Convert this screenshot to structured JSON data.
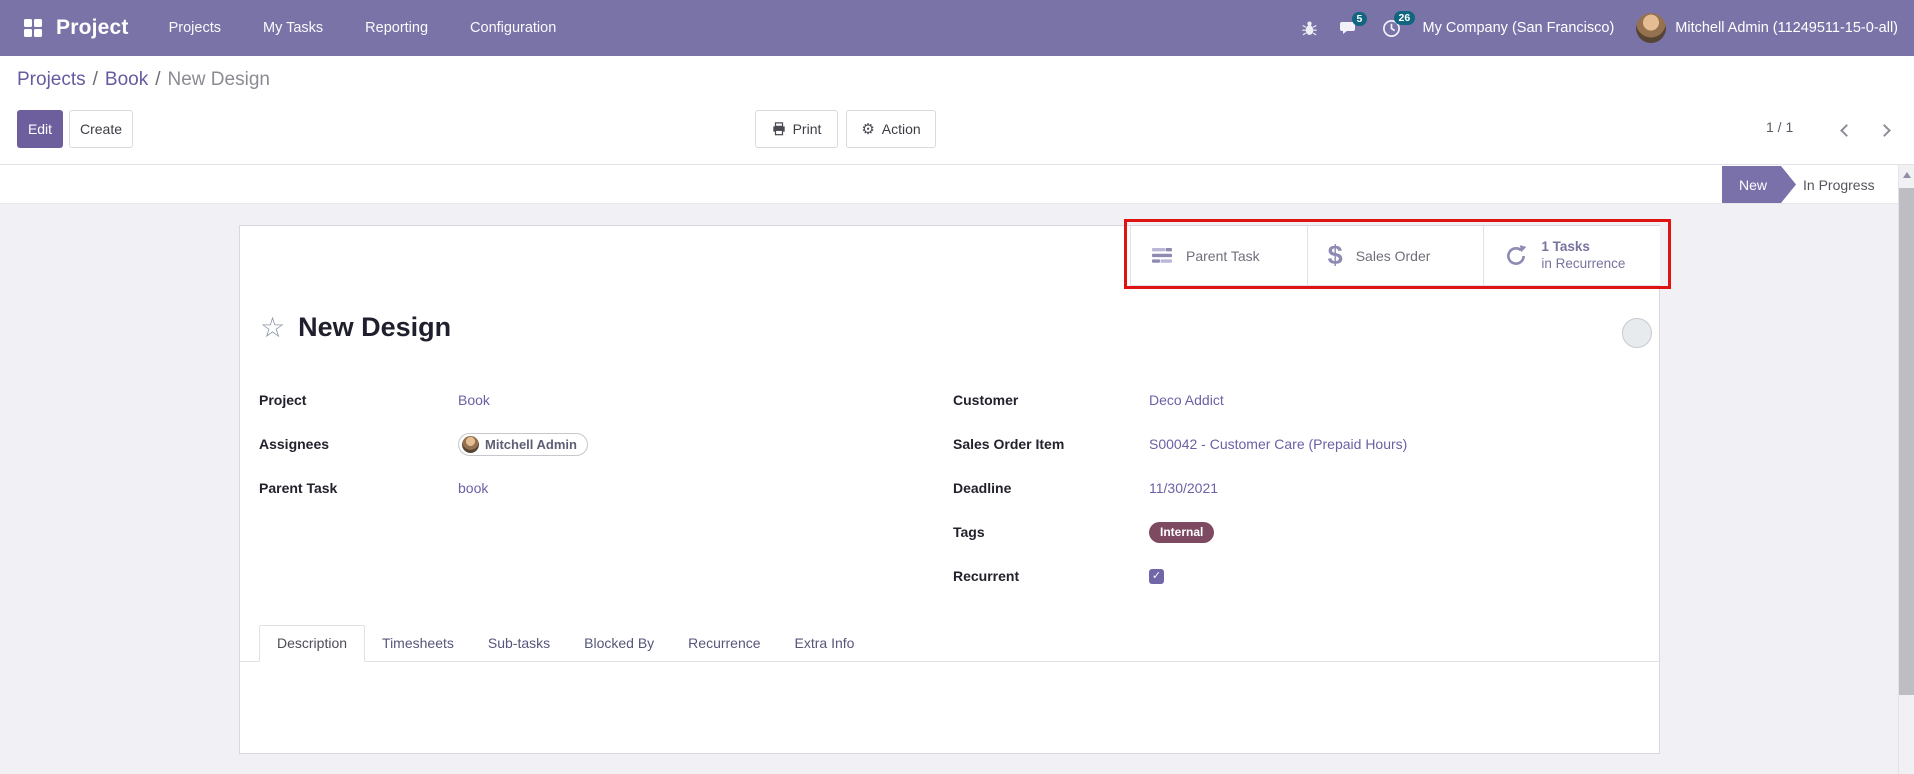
{
  "navbar": {
    "brand": "Project",
    "menu": [
      "Projects",
      "My Tasks",
      "Reporting",
      "Configuration"
    ],
    "messages_badge": "5",
    "activities_badge": "26",
    "company": "My Company (San Francisco)",
    "user": "Mitchell Admin (11249511-15-0-all)"
  },
  "breadcrumb": {
    "link1": "Projects",
    "link2": "Book",
    "current": "New Design"
  },
  "toolbar": {
    "edit": "Edit",
    "create": "Create",
    "print": "Print",
    "action": "Action"
  },
  "pager": {
    "count": "1 / 1"
  },
  "statusbar": {
    "active": "New",
    "next": "In Progress"
  },
  "smart_buttons": {
    "parent_task": {
      "label": "Parent Task",
      "icon": "tasks-icon"
    },
    "sales_order": {
      "label": "Sales Order",
      "icon": "dollar-icon"
    },
    "recurrence": {
      "value": "1 Tasks",
      "label": "in Recurrence",
      "icon": "refresh-icon"
    }
  },
  "task": {
    "title": "New Design",
    "fields_left": [
      {
        "label": "Project",
        "value": "Book"
      },
      {
        "label": "Assignees",
        "value": "Mitchell Admin"
      },
      {
        "label": "Parent Task",
        "value": "book"
      }
    ],
    "fields_right": [
      {
        "label": "Customer",
        "value": "Deco Addict"
      },
      {
        "label": "Sales Order Item",
        "value": "S00042 - Customer Care (Prepaid Hours)"
      },
      {
        "label": "Deadline",
        "value": "11/30/2021"
      },
      {
        "label": "Tags",
        "value": "Internal"
      },
      {
        "label": "Recurrent",
        "value": true
      }
    ]
  },
  "tabs": {
    "active": "Description",
    "items": [
      "Description",
      "Timesheets",
      "Sub-tasks",
      "Blocked By",
      "Recurrence",
      "Extra Info"
    ]
  },
  "colors": {
    "navbar": "#7a73a8",
    "primary_button": "#6d5f9e",
    "link": "#6b61a6",
    "badge": "#11657f",
    "stage_arrow": "#7a71ab",
    "tag_internal": "#7d4a62",
    "annotation": "#e01313"
  }
}
